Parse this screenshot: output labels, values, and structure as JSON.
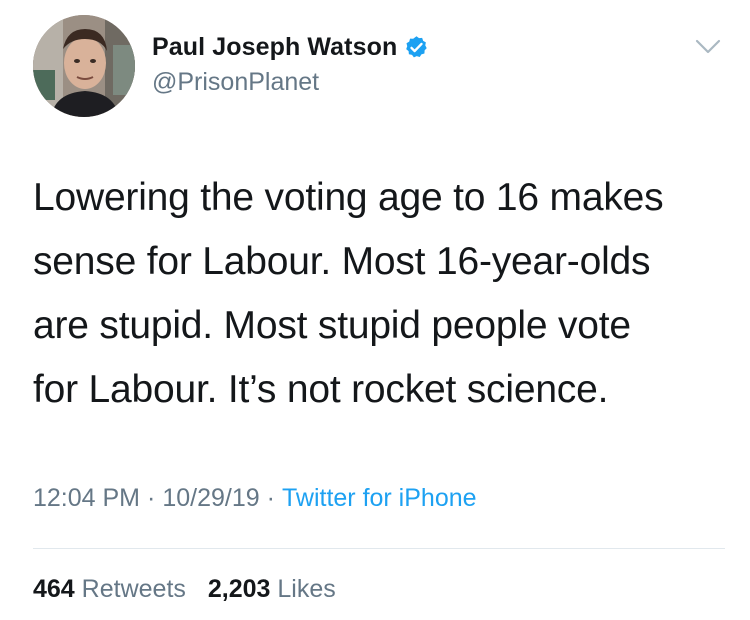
{
  "author": {
    "display_name": "Paul Joseph Watson",
    "handle": "@PrisonPlanet",
    "verified": true,
    "avatar_icon": "profile-photo"
  },
  "tweet": {
    "text_lines": [
      "Lowering the voting age to 16 makes",
      "sense for Labour. Most 16-year-olds",
      "are stupid. Most stupid people vote",
      "for Labour. It’s not rocket science."
    ]
  },
  "meta": {
    "time": "12:04 PM",
    "date": "10/29/19",
    "separator": "·",
    "source": "Twitter for iPhone"
  },
  "stats": {
    "retweets_count": "464",
    "retweets_label": "Retweets",
    "likes_count": "2,203",
    "likes_label": "Likes"
  },
  "colors": {
    "text": "#14171a",
    "secondary": "#657786",
    "accent": "#1da1f2",
    "divider": "#e1e8ed"
  }
}
